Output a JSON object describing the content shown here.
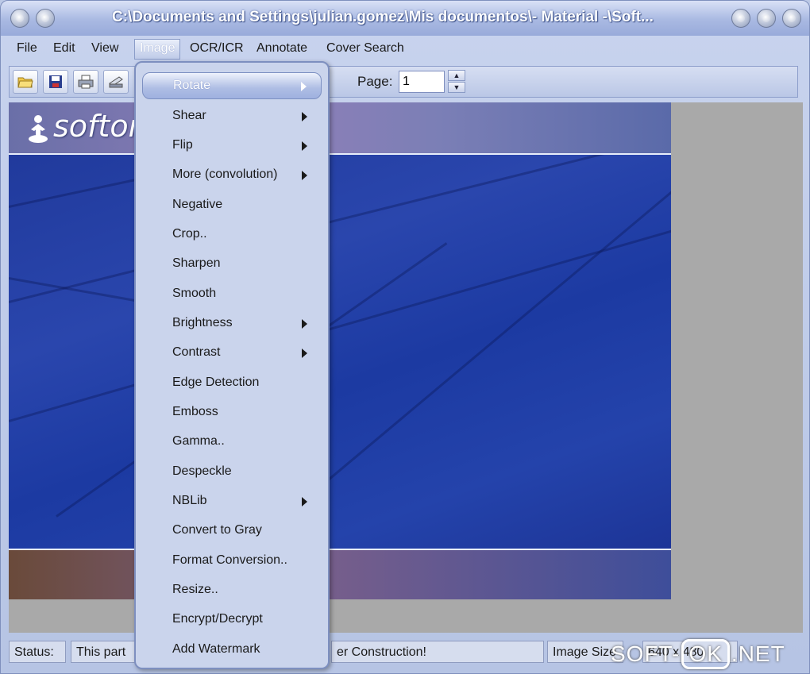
{
  "window": {
    "title": "C:\\Documents and Settings\\julian.gomez\\Mis documentos\\- Material -\\Soft..."
  },
  "menubar": {
    "items": [
      {
        "label": "File"
      },
      {
        "label": "Edit"
      },
      {
        "label": "View"
      },
      {
        "label": "Image"
      },
      {
        "label": "OCR/ICR"
      },
      {
        "label": "Annotate"
      },
      {
        "label": "Cover Search"
      }
    ]
  },
  "toolbar": {
    "page_label": "Page:",
    "page_value": "1",
    "buttons": [
      "open-folder-icon",
      "save-icon",
      "print-icon",
      "scan-icon"
    ]
  },
  "image": {
    "logo_text": "softon"
  },
  "image_menu": {
    "items": [
      {
        "label": "Rotate",
        "submenu": true
      },
      {
        "label": "Shear",
        "submenu": true
      },
      {
        "label": "Flip",
        "submenu": true
      },
      {
        "label": "More (convolution)",
        "submenu": true
      },
      {
        "label": "Negative",
        "submenu": false
      },
      {
        "label": "Crop..",
        "submenu": false
      },
      {
        "label": "Sharpen",
        "submenu": false
      },
      {
        "label": "Smooth",
        "submenu": false
      },
      {
        "label": "Brightness",
        "submenu": true
      },
      {
        "label": "Contrast",
        "submenu": true
      },
      {
        "label": "Edge Detection",
        "submenu": false
      },
      {
        "label": "Emboss",
        "submenu": false
      },
      {
        "label": "Gamma..",
        "submenu": false
      },
      {
        "label": "Despeckle",
        "submenu": false
      },
      {
        "label": "NBLib",
        "submenu": true
      },
      {
        "label": "Convert to Gray",
        "submenu": false
      },
      {
        "label": "Format Conversion..",
        "submenu": false
      },
      {
        "label": "Resize..",
        "submenu": false
      },
      {
        "label": "Encrypt/Decrypt",
        "submenu": false
      },
      {
        "label": "Add Watermark",
        "submenu": false
      }
    ]
  },
  "statusbar": {
    "status_label": "Status:",
    "message_left": "This part",
    "message_right": "er Construction!",
    "image_size_label": "Image Size",
    "image_size_value": "640 x 480"
  },
  "watermark": {
    "prefix": "SOFT-",
    "boxed": "OK",
    "suffix": ".NET"
  }
}
